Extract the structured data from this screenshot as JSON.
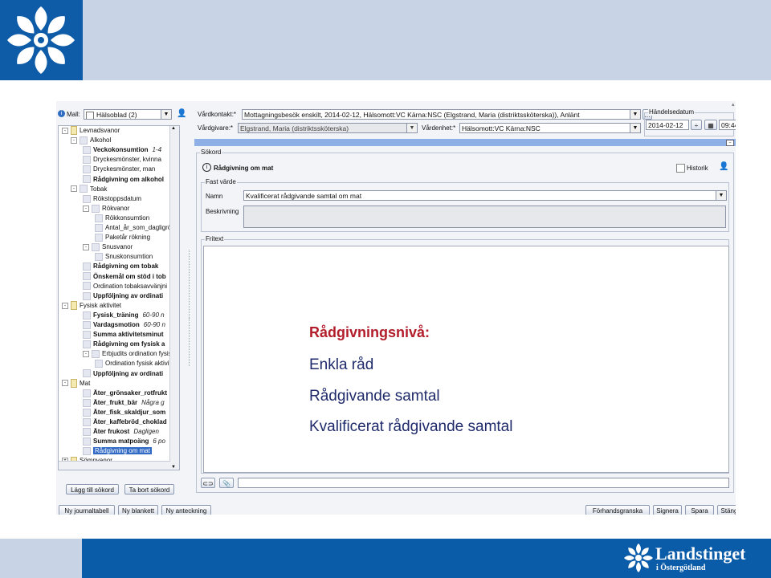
{
  "slide": {
    "overlay_heading": "Rådgivningsnivå:",
    "overlay_lines": [
      "Enkla råd",
      "Rådgivande samtal",
      "Kvalificerat rådgivande samtal"
    ],
    "brand_name": "Landstinget",
    "brand_sub": "i Östergötland",
    "colors": {
      "top_band": "#c8d3e6",
      "brand_blue": "#0a5ba8",
      "heading_red": "#b21d2b"
    }
  },
  "app": {
    "mall_label": "Mall:",
    "mall_value": "Hälsoblad (2)",
    "vardkontakt_label": "Vårdkontakt:*",
    "vardkontakt_value": "Mottagningsbesök enskilt, 2014-02-12, Hälsomott:VC Kärna:NSC (Elgstrand, Maria (distriktssköterska)), Anlänt",
    "vardgivare_label": "Vårdgivare:*",
    "vardgivare_value": "Elgstrand, Maria (distriktssköterska)",
    "vardenhet_label": "Vårdenhet:*",
    "vardenhet_value": "Hälsomott:VC Kärna:NSC",
    "handelsedatum_label": "Händelsedatum",
    "date_value": "2014-02-12",
    "time_value": "09:44",
    "sokord_title": "Sökord",
    "current_term": "Rådgivning om mat",
    "historik_label": "Historik",
    "fast_varde_title": "Fast värde",
    "namn_label": "Namn",
    "namn_value": "Kvalificerat rådgivande samtal om mat",
    "beskrivning_label": "Beskrivning",
    "fritext_title": "Fritext",
    "tree": [
      {
        "label": "Levnadsvanor",
        "level": 0,
        "kind": "folder",
        "pm": "-"
      },
      {
        "label": "Alkohol",
        "level": 1,
        "kind": "node",
        "pm": "-"
      },
      {
        "label": "Veckokonsumtion",
        "level": 2,
        "kind": "leaf",
        "bold": true,
        "value": "1-4"
      },
      {
        "label": "Dryckesmönster, kvinna",
        "level": 2,
        "kind": "leaf"
      },
      {
        "label": "Dryckesmönster, man",
        "level": 2,
        "kind": "leaf"
      },
      {
        "label": "Rådgivning om alkohol",
        "level": 2,
        "kind": "leaf",
        "bold": true
      },
      {
        "label": "Tobak",
        "level": 1,
        "kind": "node",
        "pm": "-"
      },
      {
        "label": "Rökstoppsdatum",
        "level": 2,
        "kind": "leaf"
      },
      {
        "label": "Rökvanor",
        "level": 2,
        "kind": "node",
        "pm": "-"
      },
      {
        "label": "Rökkonsumtion",
        "level": 3,
        "kind": "leaf"
      },
      {
        "label": "Antal_år_som_dagligrö",
        "level": 3,
        "kind": "leaf"
      },
      {
        "label": "Paketår rökning",
        "level": 3,
        "kind": "leaf"
      },
      {
        "label": "Snusvanor",
        "level": 2,
        "kind": "node",
        "pm": "-"
      },
      {
        "label": "Snuskonsumtion",
        "level": 3,
        "kind": "leaf"
      },
      {
        "label": "Rådgivning om tobak",
        "level": 2,
        "kind": "leaf",
        "bold": true
      },
      {
        "label": "Önskemål om stöd i tob",
        "level": 2,
        "kind": "leaf",
        "bold": true
      },
      {
        "label": "Ordination tobaksavvänjni",
        "level": 2,
        "kind": "leaf"
      },
      {
        "label": "Uppföljning av ordinati",
        "level": 2,
        "kind": "leaf",
        "bold": true
      },
      {
        "label": "Fysisk aktivitet",
        "level": 0,
        "kind": "folder",
        "pm": "-"
      },
      {
        "label": "Fysisk_träning",
        "level": 2,
        "kind": "leaf",
        "bold": true,
        "value": "60-90 n"
      },
      {
        "label": "Vardagsmotion",
        "level": 2,
        "kind": "leaf",
        "bold": true,
        "value": "60-90 n"
      },
      {
        "label": "Summa aktivitetsminut",
        "level": 2,
        "kind": "leaf",
        "bold": true
      },
      {
        "label": "Rådgivning om fysisk a",
        "level": 2,
        "kind": "leaf",
        "bold": true
      },
      {
        "label": "Erbjudits ordination fysisk a",
        "level": 2,
        "kind": "node",
        "pm": "-"
      },
      {
        "label": "Ordination fysisk aktivit",
        "level": 3,
        "kind": "leaf"
      },
      {
        "label": "Uppföljning av ordinati",
        "level": 2,
        "kind": "leaf",
        "bold": true
      },
      {
        "label": "Mat",
        "level": 0,
        "kind": "folder",
        "pm": "-"
      },
      {
        "label": "Äter_grönsaker_rotfrukt",
        "level": 2,
        "kind": "leaf",
        "bold": true
      },
      {
        "label": "Äter_frukt_bär",
        "level": 2,
        "kind": "leaf",
        "bold": true,
        "value": "Några g"
      },
      {
        "label": "Äter_fisk_skaldjur_som",
        "level": 2,
        "kind": "leaf",
        "bold": true
      },
      {
        "label": "Äter_kaffebröd_choklad",
        "level": 2,
        "kind": "leaf",
        "bold": true
      },
      {
        "label": "Äter frukost",
        "level": 2,
        "kind": "leaf",
        "bold": true,
        "value": "Dagligen"
      },
      {
        "label": "Summa matpoäng",
        "level": 2,
        "kind": "leaf",
        "bold": true,
        "value": "6 po"
      },
      {
        "label": "Rådgivning om mat",
        "level": 2,
        "kind": "leaf",
        "selected": true
      },
      {
        "label": "Sömnvanor",
        "level": 0,
        "kind": "folder",
        "pm": "+"
      }
    ],
    "add_button": "Lägg till sökord",
    "remove_button": "Ta bort sökord",
    "bottom_left_buttons": [
      "Ny journaltabell",
      "Ny blankett",
      "Ny anteckning"
    ],
    "bottom_right_buttons": [
      "Förhandsgranska",
      "Signera",
      "Spara",
      "Stäng"
    ]
  }
}
